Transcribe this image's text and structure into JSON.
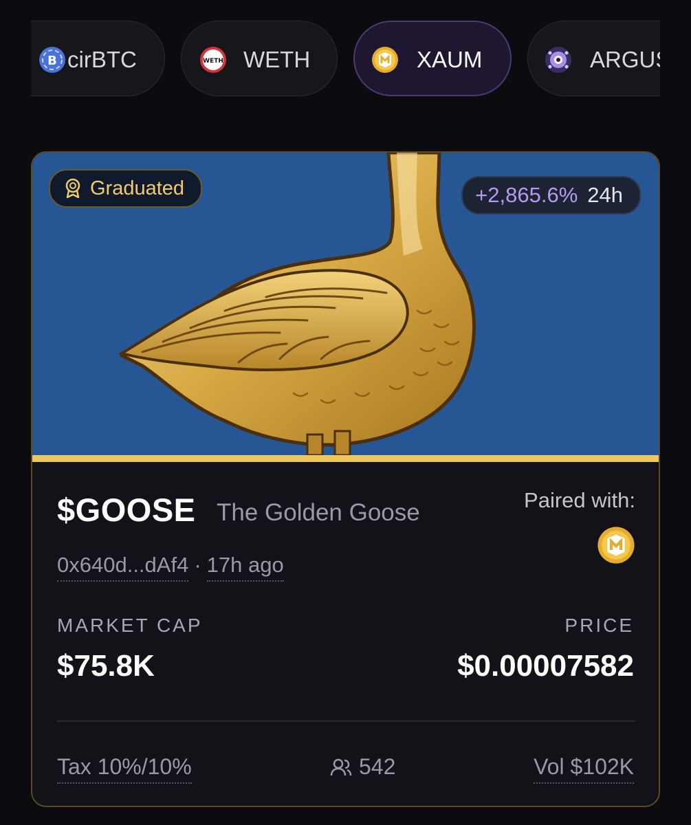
{
  "pair_tabs": [
    {
      "label": "cirBTC",
      "icon": "bitcoin-coin-icon",
      "active": false
    },
    {
      "label": "WETH",
      "icon": "weth-coin-icon",
      "icon_text": "WETH",
      "active": false
    },
    {
      "label": "XAUM",
      "icon": "xaum-coin-icon",
      "active": true
    },
    {
      "label": "ARGUS",
      "icon": "argus-coin-icon",
      "active": false
    }
  ],
  "card": {
    "graduated_label": "Graduated",
    "change_pct": "+2,865.6%",
    "change_period": "24h",
    "ticker": "$GOOSE",
    "name": "The Golden Goose",
    "address": "0x640d...dAf4",
    "separator": "·",
    "age": "17h ago",
    "paired_label": "Paired with:",
    "paired_icon": "xaum-coin-icon",
    "market_cap_label": "MARKET CAP",
    "market_cap_value": "$75.8K",
    "price_label": "PRICE",
    "price_value": "$0.00007582",
    "tax": "Tax 10%/10%",
    "holders": "542",
    "volume": "Vol $102K"
  },
  "colors": {
    "page_bg": "#0b0b10",
    "banner_bg": "#275694",
    "gold_accent": "#f0c75a",
    "change_purple": "#b59af0",
    "active_tab_border": "#4b3a73"
  }
}
